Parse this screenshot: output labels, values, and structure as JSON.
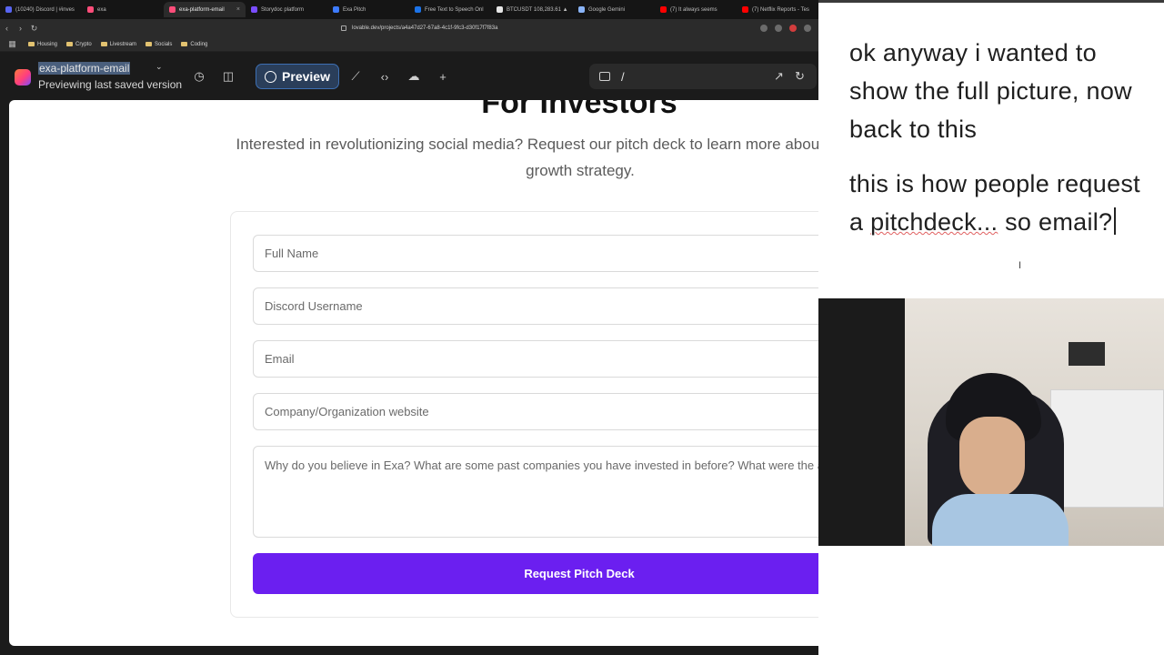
{
  "browser": {
    "tabs": [
      {
        "label": "(10240) Discord | #inves",
        "color": "#5865f2",
        "active": false
      },
      {
        "label": "exa",
        "color": "#ff4d7a",
        "active": false
      },
      {
        "label": "exa-platform-email",
        "color": "#ff4d7a",
        "active": true
      },
      {
        "label": "Storydoc platform",
        "color": "#7a4dff",
        "active": false
      },
      {
        "label": "Exa Pitch",
        "color": "#3d7bff",
        "active": false
      },
      {
        "label": "Free Text to Speech Onl",
        "color": "#1c73e8",
        "active": false
      },
      {
        "label": "BTCUSDT 108,283.61 ▲",
        "color": "#e6e6e6",
        "active": false
      },
      {
        "label": "Google Gemini",
        "color": "#8ab4f8",
        "active": false
      },
      {
        "label": "(7) It always seems",
        "color": "#ff0000",
        "active": false
      },
      {
        "label": "(7) Netflix Reports - Tes",
        "color": "#ff0000",
        "active": false
      }
    ],
    "url": "lovable.dev/projects/a4a47d27-67a8-4c1f-9fc3-d30f17f7f83a",
    "bookmarks": [
      "Housing",
      "Crypto",
      "Livestream",
      "Socials",
      "Coding"
    ]
  },
  "appbar": {
    "project_name": "exa-platform-email",
    "status": "Previewing last saved version",
    "preview_label": "Preview",
    "path": "/"
  },
  "page": {
    "heading": "For Investors",
    "subtext": "Interested in revolutionizing social media? Request our pitch deck to learn more about our vision and growth strategy.",
    "fields": {
      "full_name_placeholder": "Full Name",
      "discord_placeholder": "Discord Username",
      "email_placeholder": "Email",
      "website_placeholder": "Company/Organization website",
      "message_placeholder": "Why do you believe in Exa? What are some past companies you have invested in before? What were the amounts?"
    },
    "submit_label": "Request Pitch Deck"
  },
  "notes": {
    "note1": "ok anyway i wanted to show the full picture, now back to this",
    "note2_part1": "this is how people request a ",
    "note2_word": "pitchdeck...",
    "note2_part2": " so email?"
  }
}
